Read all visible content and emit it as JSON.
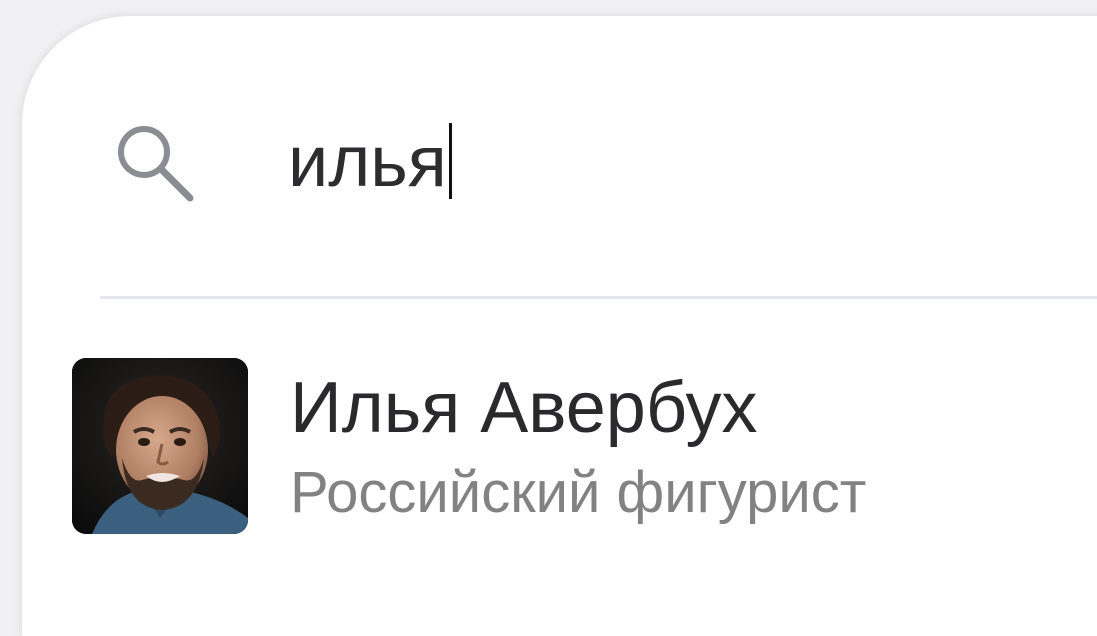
{
  "search": {
    "value": "илья",
    "icon": "search-icon"
  },
  "results": [
    {
      "name": "Илья Авербух",
      "description": "Российский фигурист",
      "avatar_icon": "person-photo"
    }
  ],
  "colors": {
    "background": "#f1f1f3",
    "panel": "#ffffff",
    "divider": "#e6e7ef",
    "text_primary": "#2a2a2c",
    "text_secondary": "#828282",
    "icon": "#8a8d91"
  }
}
